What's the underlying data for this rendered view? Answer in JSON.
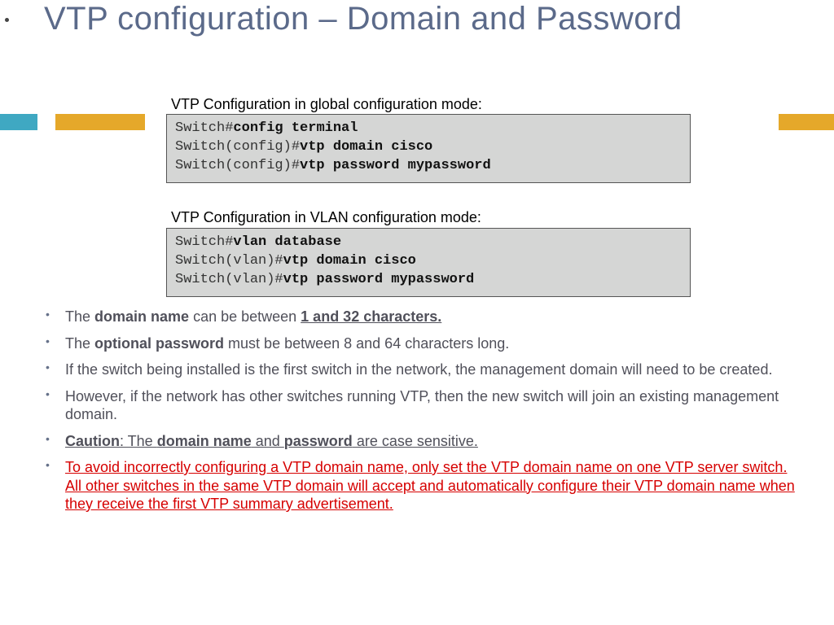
{
  "title": "VTP configuration – Domain and Password",
  "caption1": "VTP Configuration in global configuration mode:",
  "caption2": "VTP Configuration in VLAN configuration mode:",
  "code1": {
    "p1a": "Switch#",
    "p1b": "config terminal",
    "p2a": "Switch(config)#",
    "p2b": "vtp domain cisco",
    "p3a": "Switch(config)#",
    "p3b": "vtp password mypassword"
  },
  "code2": {
    "p1a": "Switch#",
    "p1b": "vlan database",
    "p2a": "Switch(vlan)#",
    "p2b": "vtp domain cisco",
    "p3a": "Switch(vlan)#",
    "p3b": "vtp password mypassword"
  },
  "b1": {
    "t1": "The ",
    "t2": "domain name",
    "t3": " can be between ",
    "t4": "1 and 32 characters."
  },
  "b2": {
    "t1": "The ",
    "t2": "optional password",
    "t3": " must be between 8 and 64 characters long."
  },
  "b3": "If the switch being installed is the first switch in the network, the management domain will need to be created.",
  "b4": "However, if the network has other switches running VTP, then the new switch will join an existing management domain.",
  "b5": {
    "t1": "Caution",
    "t2": ": The ",
    "t3": "domain name",
    "t4": " and ",
    "t5": "password",
    "t6": " are case sensitive."
  },
  "b6": "To avoid incorrectly configuring a VTP domain name, only set the VTP domain name on one VTP server switch. All other switches in the same VTP domain will accept and automatically configure their VTP domain name when they receive the first VTP summary advertisement."
}
